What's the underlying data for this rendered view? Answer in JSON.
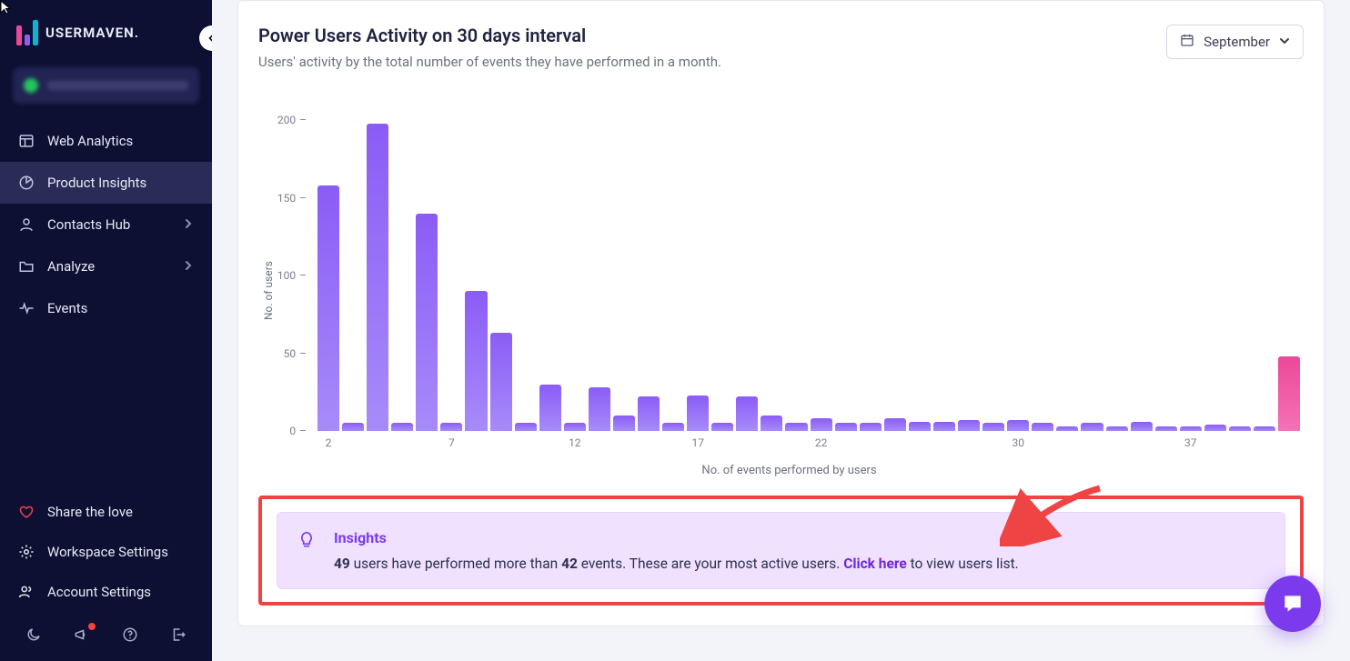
{
  "brand": {
    "name": "USERMAVEN."
  },
  "sidebar": {
    "items": [
      {
        "label": "Web Analytics",
        "icon": "layout-icon",
        "chevron": false,
        "active": false
      },
      {
        "label": "Product Insights",
        "icon": "pie-icon",
        "chevron": false,
        "active": true
      },
      {
        "label": "Contacts Hub",
        "icon": "user-icon",
        "chevron": true,
        "active": false
      },
      {
        "label": "Analyze",
        "icon": "folder-icon",
        "chevron": true,
        "active": false
      },
      {
        "label": "Events",
        "icon": "pulse-icon",
        "chevron": false,
        "active": false
      }
    ],
    "bottom": [
      {
        "label": "Share the love",
        "icon": "heart-icon"
      },
      {
        "label": "Workspace Settings",
        "icon": "gear-icon"
      },
      {
        "label": "Account Settings",
        "icon": "users-icon"
      }
    ],
    "iconrow": [
      "moon-icon",
      "megaphone-icon",
      "help-icon",
      "logout-icon"
    ]
  },
  "header": {
    "title": "Power Users Activity on 30 days interval",
    "subtitle": "Users' activity by the total number of events they have performed in a month.",
    "month": "September"
  },
  "insight": {
    "heading": "Insights",
    "count": "49",
    "mid1": " users have performed more than ",
    "threshold": "42",
    "mid2": " events. These are your most active users. ",
    "link": "Click here",
    "tail": " to view users list."
  },
  "chart_data": {
    "type": "bar",
    "title": "Power Users Activity on 30 days interval",
    "xlabel": "No. of events performed by users",
    "ylabel": "No. of users",
    "ylim": [
      0,
      210
    ],
    "yticks": [
      0,
      50,
      100,
      150,
      200
    ],
    "xticks_shown": [
      "2",
      "7",
      "12",
      "17",
      "22",
      "30",
      "37"
    ],
    "categories": [
      2,
      3,
      4,
      5,
      6,
      7,
      8,
      9,
      10,
      11,
      12,
      13,
      14,
      15,
      16,
      17,
      18,
      19,
      20,
      21,
      22,
      23,
      24,
      25,
      26,
      27,
      28,
      29,
      30,
      31,
      32,
      33,
      34,
      35,
      36,
      37,
      38,
      39,
      40,
      41
    ],
    "values": [
      158,
      5,
      198,
      5,
      140,
      5,
      90,
      63,
      5,
      30,
      5,
      28,
      10,
      22,
      5,
      23,
      5,
      22,
      10,
      5,
      8,
      5,
      5,
      8,
      6,
      6,
      7,
      5,
      7,
      5,
      3,
      5,
      3,
      6,
      3,
      3,
      4,
      3,
      3,
      48
    ],
    "last_bar_highlight": true
  }
}
